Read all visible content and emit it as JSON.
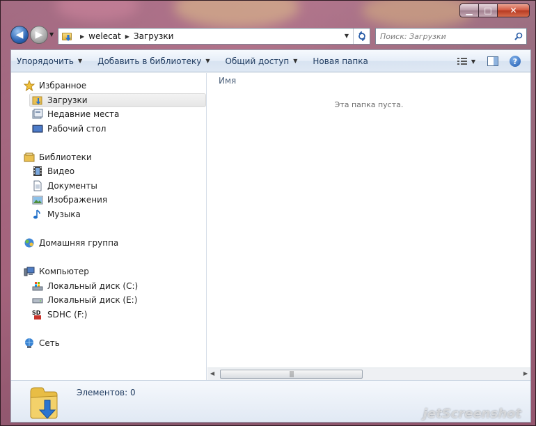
{
  "window": {
    "caption_buttons": {
      "minimize": "▁",
      "maximize": "□",
      "close": "✕"
    }
  },
  "nav": {
    "breadcrumbs": [
      "welecat",
      "Загрузки"
    ],
    "search_placeholder": "Поиск: Загрузки"
  },
  "toolbar": {
    "organize": "Упорядочить",
    "add_to_library": "Добавить в библиотеку",
    "share": "Общий доступ",
    "new_folder": "Новая папка"
  },
  "navpane": {
    "favorites": {
      "label": "Избранное",
      "items": [
        {
          "label": "Загрузки",
          "icon": "downloads-folder-icon",
          "selected": true
        },
        {
          "label": "Недавние места",
          "icon": "recent-places-icon"
        },
        {
          "label": "Рабочий стол",
          "icon": "desktop-icon"
        }
      ]
    },
    "libraries": {
      "label": "Библиотеки",
      "items": [
        {
          "label": "Видео",
          "icon": "video-library-icon"
        },
        {
          "label": "Документы",
          "icon": "documents-library-icon"
        },
        {
          "label": "Изображения",
          "icon": "pictures-library-icon"
        },
        {
          "label": "Музыка",
          "icon": "music-library-icon"
        }
      ]
    },
    "homegroup": {
      "label": "Домашняя группа"
    },
    "computer": {
      "label": "Компьютер",
      "items": [
        {
          "label": "Локальный диск (C:)",
          "icon": "system-drive-icon"
        },
        {
          "label": "Локальный диск (E:)",
          "icon": "local-drive-icon"
        },
        {
          "label": "SDHC (F:)",
          "icon": "sd-card-icon"
        }
      ]
    },
    "network": {
      "label": "Сеть"
    }
  },
  "content": {
    "column_header": "Имя",
    "empty_message": "Эта папка пуста.",
    "scroll_grip": "|||"
  },
  "details": {
    "items_count": "Элементов: 0"
  },
  "watermark": "jetScreenshot",
  "colors": {
    "accent": "#2b74cf",
    "toolbar_text": "#1e3a5f",
    "folder_yellow": "#e8bd45"
  }
}
